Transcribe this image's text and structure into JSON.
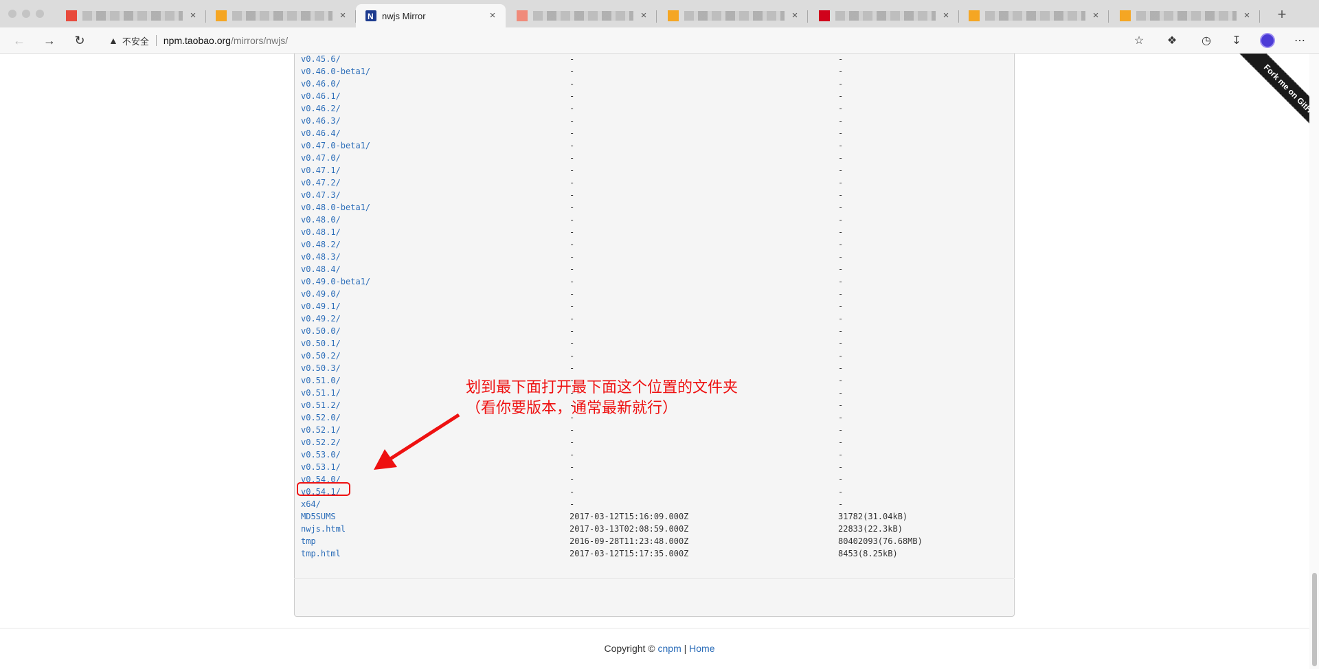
{
  "browser": {
    "tabs": [
      {
        "title": "",
        "favicon_color": "#e84a3c"
      },
      {
        "title": "",
        "favicon_color": "#f5a623"
      },
      {
        "title": "nwjs Mirror",
        "favicon_color": "#1d3b8f",
        "active": true
      },
      {
        "title": "",
        "favicon_color": "#f08a7a"
      },
      {
        "title": "",
        "favicon_color": "#f5a623"
      },
      {
        "title": "",
        "favicon_color": "#d0021b"
      },
      {
        "title": "",
        "favicon_color": "#f5a623"
      },
      {
        "title": "",
        "favicon_color": "#f5a623"
      }
    ],
    "new_tab_label": "+",
    "security_label": "不安全",
    "url_host": "npm.taobao.org",
    "url_path": "/mirrors/nwjs/"
  },
  "listing": [
    {
      "name": "v0.45.6/",
      "date": "-",
      "size": "-"
    },
    {
      "name": "v0.46.0-beta1/",
      "date": "-",
      "size": "-"
    },
    {
      "name": "v0.46.0/",
      "date": "-",
      "size": "-"
    },
    {
      "name": "v0.46.1/",
      "date": "-",
      "size": "-"
    },
    {
      "name": "v0.46.2/",
      "date": "-",
      "size": "-"
    },
    {
      "name": "v0.46.3/",
      "date": "-",
      "size": "-"
    },
    {
      "name": "v0.46.4/",
      "date": "-",
      "size": "-"
    },
    {
      "name": "v0.47.0-beta1/",
      "date": "-",
      "size": "-"
    },
    {
      "name": "v0.47.0/",
      "date": "-",
      "size": "-"
    },
    {
      "name": "v0.47.1/",
      "date": "-",
      "size": "-"
    },
    {
      "name": "v0.47.2/",
      "date": "-",
      "size": "-"
    },
    {
      "name": "v0.47.3/",
      "date": "-",
      "size": "-"
    },
    {
      "name": "v0.48.0-beta1/",
      "date": "-",
      "size": "-"
    },
    {
      "name": "v0.48.0/",
      "date": "-",
      "size": "-"
    },
    {
      "name": "v0.48.1/",
      "date": "-",
      "size": "-"
    },
    {
      "name": "v0.48.2/",
      "date": "-",
      "size": "-"
    },
    {
      "name": "v0.48.3/",
      "date": "-",
      "size": "-"
    },
    {
      "name": "v0.48.4/",
      "date": "-",
      "size": "-"
    },
    {
      "name": "v0.49.0-beta1/",
      "date": "-",
      "size": "-"
    },
    {
      "name": "v0.49.0/",
      "date": "-",
      "size": "-"
    },
    {
      "name": "v0.49.1/",
      "date": "-",
      "size": "-"
    },
    {
      "name": "v0.49.2/",
      "date": "-",
      "size": "-"
    },
    {
      "name": "v0.50.0/",
      "date": "-",
      "size": "-"
    },
    {
      "name": "v0.50.1/",
      "date": "-",
      "size": "-"
    },
    {
      "name": "v0.50.2/",
      "date": "-",
      "size": "-"
    },
    {
      "name": "v0.50.3/",
      "date": "-",
      "size": "-"
    },
    {
      "name": "v0.51.0/",
      "date": "-",
      "size": "-"
    },
    {
      "name": "v0.51.1/",
      "date": "-",
      "size": "-"
    },
    {
      "name": "v0.51.2/",
      "date": "-",
      "size": "-"
    },
    {
      "name": "v0.52.0/",
      "date": "-",
      "size": "-"
    },
    {
      "name": "v0.52.1/",
      "date": "-",
      "size": "-"
    },
    {
      "name": "v0.52.2/",
      "date": "-",
      "size": "-"
    },
    {
      "name": "v0.53.0/",
      "date": "-",
      "size": "-"
    },
    {
      "name": "v0.53.1/",
      "date": "-",
      "size": "-"
    },
    {
      "name": "v0.54.0/",
      "date": "-",
      "size": "-"
    },
    {
      "name": "v0.54.1/",
      "date": "-",
      "size": "-",
      "highlighted": true
    },
    {
      "name": "x64/",
      "date": "-",
      "size": "-"
    },
    {
      "name": "MD5SUMS",
      "date": "2017-03-12T15:16:09.000Z",
      "size": "31782(31.04kB)"
    },
    {
      "name": "nwjs.html",
      "date": "2017-03-13T02:08:59.000Z",
      "size": "22833(22.3kB)"
    },
    {
      "name": "tmp",
      "date": "2016-09-28T11:23:48.000Z",
      "size": "80402093(76.68MB)"
    },
    {
      "name": "tmp.html",
      "date": "2017-03-12T15:17:35.000Z",
      "size": "8453(8.25kB)"
    }
  ],
  "annotation": {
    "line1": "划到最下面打开最下面这个位置的文件夹",
    "line2": "（看你要版本，通常最新就行）",
    "color": "#ee1111"
  },
  "ribbon": {
    "text": "Fork me on GitHub"
  },
  "footer": {
    "copyright": "Copyright ©",
    "link1": "cnpm",
    "separator": "|",
    "link2": "Home"
  },
  "colors": {
    "link": "#2a6cb8",
    "listing_bg": "#f5f5f5"
  }
}
